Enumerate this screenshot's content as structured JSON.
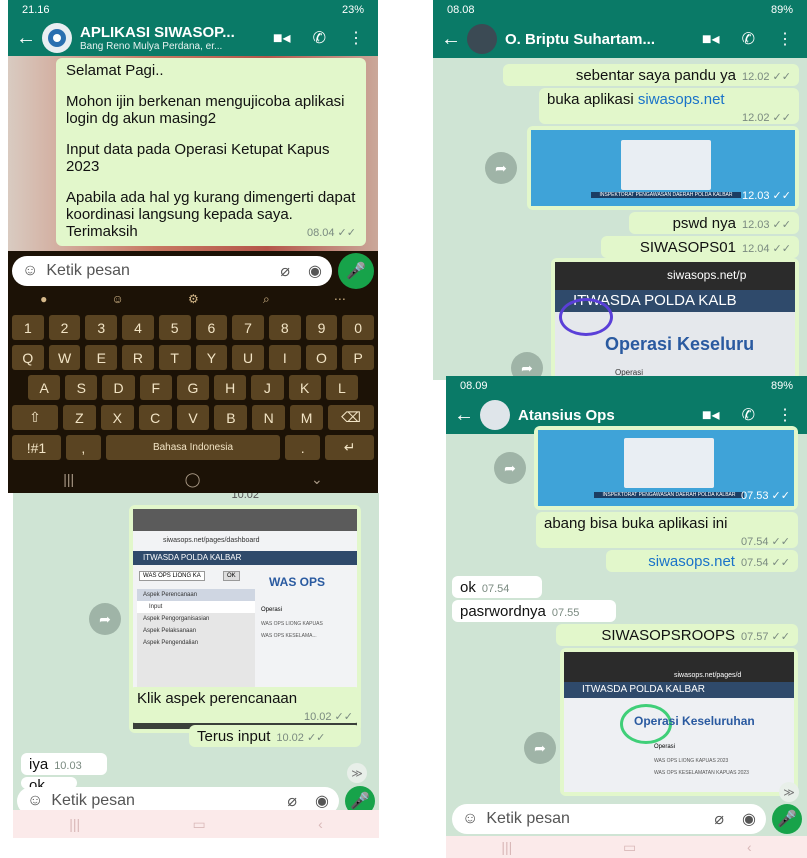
{
  "p1": {
    "status": {
      "time": "21.16",
      "battery": "23%"
    },
    "contact": {
      "name": "APLIKASI SIWASOP...",
      "subtitle": "Bang Reno Mulya Perdana, er..."
    },
    "message": {
      "lines": [
        "Selamat Pagi..",
        "Mohon ijin berkenan mengujicoba aplikasi login dg akun masing2",
        "Input data pada Operasi Ketupat Kapus 2023",
        "Apabila ada hal yg kurang dimengerti dapat koordinasi langsung kepada saya. Terimaksih"
      ],
      "time": "08.04"
    },
    "input_placeholder": "Ketik pesan",
    "keyboard": {
      "row1": [
        "1",
        "2",
        "3",
        "4",
        "5",
        "6",
        "7",
        "8",
        "9",
        "0"
      ],
      "row2": [
        "Q",
        "W",
        "E",
        "R",
        "T",
        "Y",
        "U",
        "I",
        "O",
        "P"
      ],
      "row3": [
        "A",
        "S",
        "D",
        "F",
        "G",
        "H",
        "J",
        "K",
        "L"
      ],
      "row4": [
        "Z",
        "X",
        "C",
        "V",
        "B",
        "N",
        "M"
      ],
      "symbols": "!#1",
      "comma": ",",
      "space": "Bahasa Indonesia",
      "period": "."
    }
  },
  "p2": {
    "time_top": "10.02",
    "screenshot": {
      "url": "siwasops.net/pages/dashboard",
      "brand": "ITWASDA POLDA KALBAR",
      "select": "WAS OPS LIONG KA",
      "ok": "OK",
      "title": "WAS OPS",
      "menu": [
        "Aspek Perencanaan",
        "Input",
        "Aspek Pengorganisasian",
        "Aspek Pelaksanaan",
        "Aspek Pengendalian"
      ],
      "ops_head": "Operasi",
      "ops": [
        "WAS OPS LIONG KAPUAS",
        "WAS OPS KESELAMA..."
      ]
    },
    "msgs": [
      {
        "text": "Klik aspek perencanaan",
        "time": "10.02"
      },
      {
        "text": "Terus input",
        "time": "10.02"
      },
      {
        "text": "iya",
        "time": "10.03"
      },
      {
        "text": "ok",
        "time": ""
      }
    ],
    "input_placeholder": "Ketik pesan"
  },
  "p3": {
    "status": {
      "time": "08.08",
      "battery": "89%"
    },
    "contact": {
      "name": "O. Briptu Suhartam..."
    },
    "msgs": [
      {
        "text": "sebentar saya pandu ya",
        "time": "12.02"
      },
      {
        "text": "buka aplikasi",
        "link": "siwasops.net",
        "time": "12.02"
      },
      {
        "text": "pswd nya",
        "time": "12.03"
      },
      {
        "text": "SIWASOPS01",
        "time": "12.04"
      }
    ],
    "image_time": "12.03",
    "login_caption": "INSPEKTORAT PENGAWASAN DAERAH POLDA KALBAR",
    "screenshot2": {
      "url": "siwasops.net/p",
      "brand": "ITWASDA POLDA KALB",
      "title": "Operasi Keseluru",
      "sub": "Operasi"
    }
  },
  "p4": {
    "status": {
      "time": "08.09",
      "battery": "89%"
    },
    "contact": {
      "name": "Atansius Ops"
    },
    "image_time": "07.53",
    "login_caption": "INSPEKTORAT PENGAWASAN DAERAH POLDA KALBAR",
    "msgs": [
      {
        "text": "abang bisa buka aplikasi ini",
        "time": "07.54"
      },
      {
        "link": "siwasops.net",
        "time": "07.54"
      },
      {
        "text": "ok",
        "time": "07.54"
      },
      {
        "text": "pasrwordnya",
        "time": "07.55"
      },
      {
        "text": "SIWASOPSROOPS",
        "time": "07.57"
      }
    ],
    "screenshot": {
      "url": "siwasops.net/pages/d",
      "brand": "ITWASDA POLDA KALBAR",
      "title": "Operasi Keseluruhan",
      "ops_head": "Operasi",
      "ops": [
        "WAS OPS LIONG KAPUAS 2023",
        "WAS OPS KESELAMATAN KAPUAS 2023"
      ]
    },
    "input_placeholder": "Ketik pesan"
  },
  "colors": {
    "header_green": "#0a7a67",
    "mic_green": "#17a34a",
    "keyboard_bg": "#1c1206",
    "key_bg": "#5a4422",
    "link": "#1a73c9"
  }
}
